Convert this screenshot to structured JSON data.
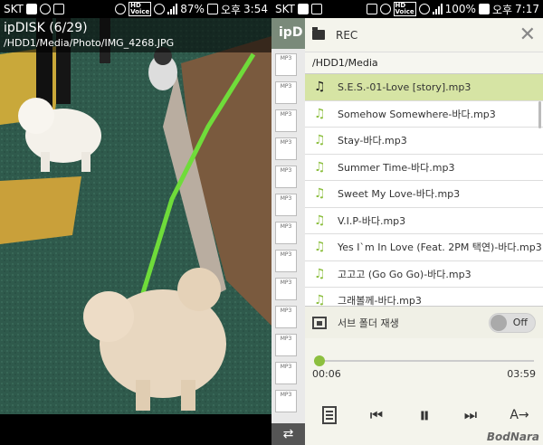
{
  "left_status": {
    "carrier": "SKT",
    "hd": "HD",
    "voice": "Voice",
    "battery": "87%",
    "ampm": "오후",
    "time": "3:54"
  },
  "right_status": {
    "carrier": "SKT",
    "hd": "HD",
    "voice": "Voice",
    "battery": "100%",
    "ampm": "오후",
    "time": "7:17"
  },
  "viewer": {
    "title": "ipDISK (6/29)",
    "path": "/HDD1/Media/Photo/IMG_4268.JPG"
  },
  "middle": {
    "header": "ipD",
    "thumb_label": "MP3"
  },
  "browser": {
    "title": "REC",
    "path": "/HDD1/Media",
    "items": [
      {
        "label": "S.E.S.-01-Love [story].mp3",
        "active": true
      },
      {
        "label": "Somehow Somewhere-바다.mp3",
        "active": false
      },
      {
        "label": "Stay-바다.mp3",
        "active": false
      },
      {
        "label": "Summer Time-바다.mp3",
        "active": false
      },
      {
        "label": "Sweet My Love-바다.mp3",
        "active": false
      },
      {
        "label": "V.I.P-바다.mp3",
        "active": false
      },
      {
        "label": "Yes I`m In Love (Feat. 2PM 택연)-바다.mp3",
        "active": false
      },
      {
        "label": "고고고 (Go Go Go)-바다.mp3",
        "active": false
      },
      {
        "label": "그래볼께-바다.mp3",
        "active": false
      }
    ]
  },
  "subfolder": {
    "label": "서브 폴더 재생",
    "toggle": "Off"
  },
  "player": {
    "current": "00:06",
    "total": "03:59",
    "progress": 0.025
  },
  "watermark": "BodNara",
  "colors": {
    "accent": "#8cbf3f",
    "active_row": "#d6e4a4"
  }
}
